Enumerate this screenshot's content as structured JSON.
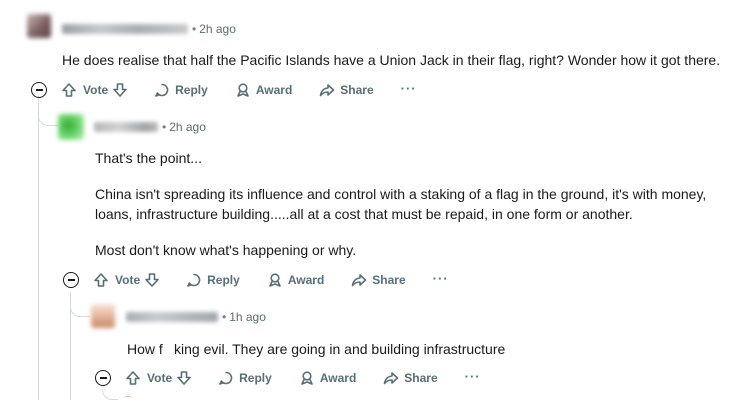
{
  "comments": [
    {
      "time": "2h ago",
      "body": [
        "He does realise that half the Pacific Islands have a Union Jack in their flag, right? Wonder how it got there."
      ],
      "avatar_color": "#8a6a6a"
    },
    {
      "time": "2h ago",
      "body": [
        "That's the point...",
        "China isn't spreading its influence and control with a staking of a flag in the ground, it's with money, loans, infrastructure building.....all at a cost that must be repaid, in one form or another.",
        "Most don't know what's happening or why."
      ],
      "avatar_color": "#4caf50"
    },
    {
      "time": "1h ago",
      "body": [
        "How f    king evil. They are going in and building infrastructure"
      ],
      "avatar_color": "#d9a080"
    }
  ],
  "actions": {
    "vote": "Vote",
    "reply": "Reply",
    "award": "Award",
    "share": "Share",
    "more": "···"
  },
  "icons": [
    "collapse-icon",
    "upvote-icon",
    "downvote-icon",
    "reply-icon",
    "award-icon",
    "share-icon",
    "more-icon"
  ]
}
